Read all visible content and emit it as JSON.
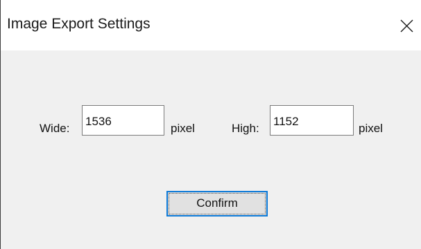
{
  "window": {
    "title": "Image Export Settings",
    "close_icon": "close-icon"
  },
  "form": {
    "width_label": "Wide:",
    "width_value": "1536",
    "width_unit": "pixel",
    "height_label": "High:",
    "height_value": "1152",
    "height_unit": "pixel"
  },
  "actions": {
    "confirm_label": "Confirm"
  },
  "colors": {
    "accent": "#0a78d7",
    "dialog_background": "#f0f0f0",
    "titlebar_background": "#ffffff",
    "button_background": "#e1e1e1"
  }
}
